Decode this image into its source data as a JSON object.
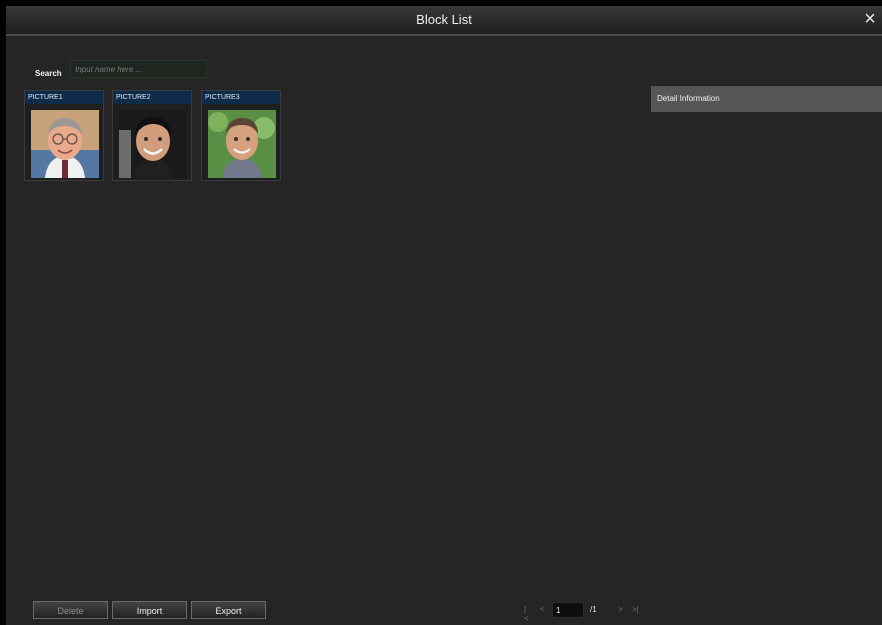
{
  "window": {
    "title": "Block List",
    "close_icon": "close-icon"
  },
  "search": {
    "label": "Search",
    "placeholder": "Input name here ..."
  },
  "pictures": [
    {
      "label": "PICTURE1",
      "face": "face-portrait-1"
    },
    {
      "label": "PICTURE2",
      "face": "face-portrait-2"
    },
    {
      "label": "PICTURE3",
      "face": "face-portrait-3"
    }
  ],
  "detail": {
    "title": "Detail Information"
  },
  "toolbar": {
    "delete_label": "Delete",
    "import_label": "Import",
    "export_label": "Export"
  },
  "pagination": {
    "first_icon": "first-page-icon",
    "prev_icon": "prev-page-icon",
    "current_page": "1",
    "total_pages": "/1",
    "next_icon": "next-page-icon",
    "last_icon": "last-page-icon"
  },
  "colors": {
    "background": "#252525",
    "card_label_bg": "#0e2c4a",
    "detail_bar_bg": "#565656"
  }
}
